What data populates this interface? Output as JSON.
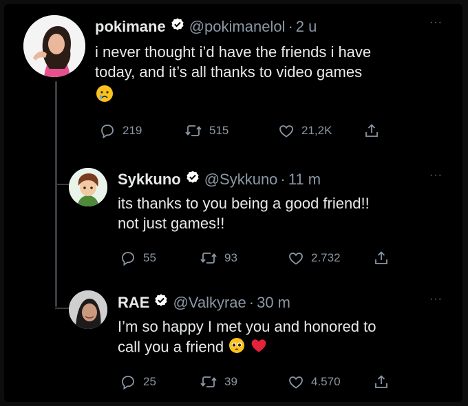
{
  "tweets": [
    {
      "name": "pokimane",
      "handle": "@pokimanelol",
      "separator": "·",
      "time": "2 u",
      "text_line1": "i never thought i’d have the friends i have",
      "text_line2": "today, and it’s all thanks to video games",
      "emoji": "crying-face",
      "replies": "219",
      "retweets": "515",
      "likes": "21,2K",
      "more": "···"
    },
    {
      "name": "Sykkuno",
      "handle": "@Sykkuno",
      "separator": "·",
      "time": "11 m",
      "text_line1": "its thanks to you being a good friend!!",
      "text_line2": "not just games!!",
      "replies": "55",
      "retweets": "93",
      "likes": "2.732",
      "more": "···"
    },
    {
      "name": "RAE",
      "handle": "@Valkyrae",
      "separator": "·",
      "time": "30 m",
      "text_line1": "I’m so happy I met you and honored to",
      "text_line2": "call you a friend",
      "emoji": "pleading-face red-heart",
      "replies": "25",
      "retweets": "39",
      "likes": "4.570",
      "more": "···"
    }
  ],
  "colors": {
    "background": "#000000",
    "text": "#e7e9ea",
    "secondary": "#8b98a5",
    "verified": "#ffffff",
    "heart": "#e0245e"
  }
}
